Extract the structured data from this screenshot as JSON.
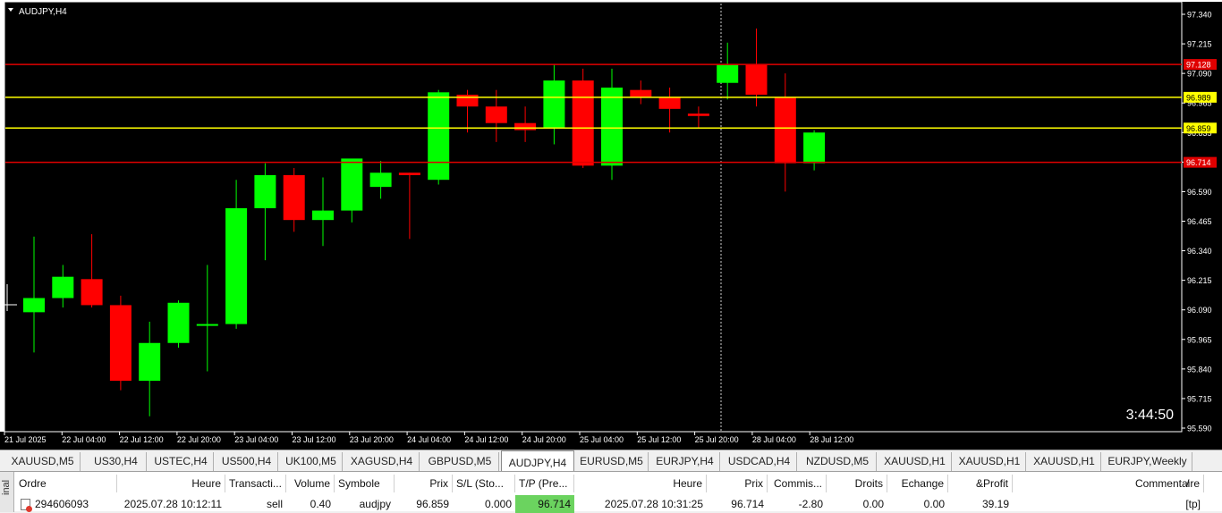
{
  "chart": {
    "symbol_label": "AUDJPY,H4",
    "timer": "3:44:50",
    "colors": {
      "background": "#000000",
      "bull": "#00ff00",
      "bear": "#ff0000",
      "grid_text": "#ffffff",
      "hline_red": "#e00000",
      "hline_yellow": "#ffff00",
      "crosshair": "#d0d0d0"
    },
    "y_ticks": [
      "97.340",
      "97.215",
      "97.090",
      "96.965",
      "96.835",
      "96.710",
      "96.590",
      "96.465",
      "96.340",
      "96.215",
      "96.090",
      "95.965",
      "95.840",
      "95.715",
      "95.590"
    ],
    "x_ticks": [
      "21 Jul 2025",
      "22 Jul 04:00",
      "22 Jul 12:00",
      "22 Jul 20:00",
      "23 Jul 04:00",
      "23 Jul 12:00",
      "23 Jul 20:00",
      "24 Jul 04:00",
      "24 Jul 12:00",
      "24 Jul 20:00",
      "25 Jul 04:00",
      "25 Jul 12:00",
      "25 Jul 20:00",
      "28 Jul 04:00",
      "28 Jul 12:00"
    ],
    "price_labels": [
      {
        "value": 97.128,
        "text": "97.128",
        "color": "#e00000"
      },
      {
        "value": 96.989,
        "text": "96.989",
        "color": "#ffff00"
      },
      {
        "value": 96.859,
        "text": "96.859",
        "color": "#ffff00"
      },
      {
        "value": 96.714,
        "text": "96.714",
        "color": "#e00000"
      }
    ]
  },
  "chart_data": {
    "type": "candlestick",
    "symbol": "AUDJPY",
    "timeframe": "H4",
    "ylim": [
      95.59,
      97.34
    ],
    "candles": [
      {
        "o": 96.08,
        "h": 96.4,
        "l": 95.91,
        "c": 96.14
      },
      {
        "o": 96.14,
        "h": 96.28,
        "l": 96.1,
        "c": 96.23
      },
      {
        "o": 96.22,
        "h": 96.41,
        "l": 96.1,
        "c": 96.11
      },
      {
        "o": 96.11,
        "h": 96.15,
        "l": 95.75,
        "c": 95.79
      },
      {
        "o": 95.79,
        "h": 96.04,
        "l": 95.64,
        "c": 95.95
      },
      {
        "o": 95.95,
        "h": 96.13,
        "l": 95.93,
        "c": 96.12
      },
      {
        "o": 96.03,
        "h": 96.28,
        "l": 95.83,
        "c": 96.03
      },
      {
        "o": 96.03,
        "h": 96.64,
        "l": 96.01,
        "c": 96.52
      },
      {
        "o": 96.52,
        "h": 96.71,
        "l": 96.3,
        "c": 96.66
      },
      {
        "o": 96.66,
        "h": 96.69,
        "l": 96.42,
        "c": 96.47
      },
      {
        "o": 96.47,
        "h": 96.65,
        "l": 96.36,
        "c": 96.51
      },
      {
        "o": 96.51,
        "h": 96.71,
        "l": 96.46,
        "c": 96.73
      },
      {
        "o": 96.61,
        "h": 96.72,
        "l": 96.56,
        "c": 96.67
      },
      {
        "o": 96.67,
        "h": 96.67,
        "l": 96.39,
        "c": 96.66
      },
      {
        "o": 96.64,
        "h": 97.02,
        "l": 96.62,
        "c": 97.01
      },
      {
        "o": 97.0,
        "h": 97.02,
        "l": 96.84,
        "c": 96.95
      },
      {
        "o": 96.95,
        "h": 97.02,
        "l": 96.8,
        "c": 96.88
      },
      {
        "o": 96.88,
        "h": 96.95,
        "l": 96.8,
        "c": 96.85
      },
      {
        "o": 96.86,
        "h": 97.13,
        "l": 96.79,
        "c": 97.06
      },
      {
        "o": 97.06,
        "h": 97.11,
        "l": 96.69,
        "c": 96.7
      },
      {
        "o": 96.7,
        "h": 97.11,
        "l": 96.64,
        "c": 97.03
      },
      {
        "o": 97.02,
        "h": 97.06,
        "l": 96.96,
        "c": 96.99
      },
      {
        "o": 96.99,
        "h": 97.03,
        "l": 96.84,
        "c": 96.94
      },
      {
        "o": 96.92,
        "h": 96.95,
        "l": 96.86,
        "c": 96.91
      },
      {
        "o": 97.05,
        "h": 97.22,
        "l": 96.98,
        "c": 97.13
      },
      {
        "o": 97.13,
        "h": 97.28,
        "l": 96.95,
        "c": 97.0
      },
      {
        "o": 96.99,
        "h": 97.09,
        "l": 96.59,
        "c": 96.71
      },
      {
        "o": 96.71,
        "h": 96.85,
        "l": 96.68,
        "c": 96.84
      }
    ],
    "hlines": [
      97.128,
      96.989,
      96.859,
      96.714
    ]
  },
  "tabs": [
    {
      "label": "XAUUSD,M5"
    },
    {
      "label": "US30,H4"
    },
    {
      "label": "USTEC,H4"
    },
    {
      "label": "US500,H4"
    },
    {
      "label": "UK100,M5"
    },
    {
      "label": "XAGUSD,H4"
    },
    {
      "label": "GBPUSD,M5"
    },
    {
      "label": "AUDJPY,H4",
      "active": true
    },
    {
      "label": "EURUSD,M5"
    },
    {
      "label": "EURJPY,H4"
    },
    {
      "label": "USDCAD,H4"
    },
    {
      "label": "NZDUSD,M5"
    },
    {
      "label": "XAUUSD,H1"
    },
    {
      "label": "XAUUSD,H1"
    },
    {
      "label": "XAUUSD,H1"
    },
    {
      "label": "EURJPY,Weekly"
    }
  ],
  "terminal": {
    "side_label": "inal",
    "headers": [
      "Ordre",
      "Heure",
      "Transacti...",
      "Volume",
      "Symbole",
      "Prix",
      "S/L (Sto...",
      "T/P (Pre...",
      "Heure",
      "Prix",
      "Commis...",
      "Droits",
      "Echange",
      "&Profit",
      "Commentaire"
    ],
    "sort_indicator": "/",
    "row": [
      "294606093",
      "2025.07.28 10:12:11",
      "sell",
      "0.40",
      "audjpy",
      "96.859",
      "0.000",
      "96.714",
      "2025.07.28 10:31:25",
      "96.714",
      "-2.80",
      "0.00",
      "0.00",
      "39.19",
      "[tp]"
    ]
  }
}
